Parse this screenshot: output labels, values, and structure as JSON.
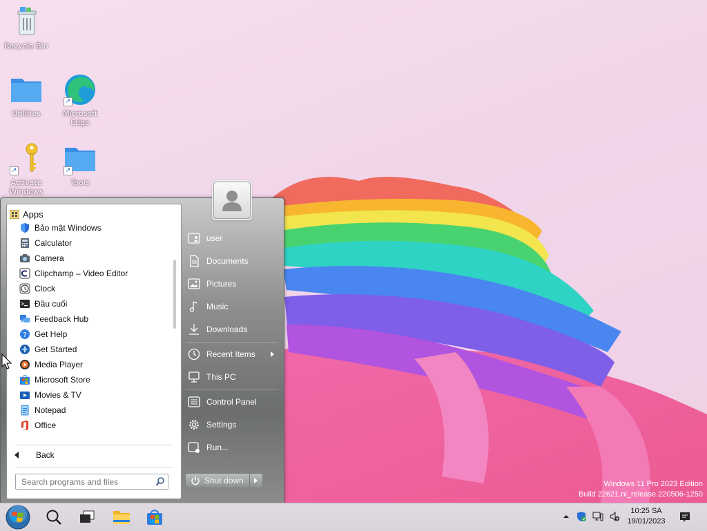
{
  "desktop": {
    "icons": [
      {
        "label": "Recycle Bin",
        "icon": "recycle-bin-icon"
      },
      {
        "label": "Utilities",
        "icon": "folder-icon"
      },
      {
        "label": "Microsoft Edge",
        "icon": "edge-icon"
      },
      {
        "label": "Activate Windows",
        "icon": "key-icon"
      },
      {
        "label": "Tools",
        "icon": "folder-shortcut-icon"
      }
    ]
  },
  "start_menu": {
    "apps_header": "Apps",
    "apps": [
      {
        "label": "Bảo mật Windows",
        "icon": "shield-icon"
      },
      {
        "label": "Calculator",
        "icon": "calculator-icon"
      },
      {
        "label": "Camera",
        "icon": "camera-icon"
      },
      {
        "label": "Clipchamp – Video Editor",
        "icon": "clipchamp-icon"
      },
      {
        "label": "Clock",
        "icon": "clock-icon"
      },
      {
        "label": "Đầu cuối",
        "icon": "terminal-icon"
      },
      {
        "label": "Feedback Hub",
        "icon": "feedback-icon"
      },
      {
        "label": "Get Help",
        "icon": "help-icon"
      },
      {
        "label": "Get Started",
        "icon": "get-started-icon"
      },
      {
        "label": "Media Player",
        "icon": "media-player-icon"
      },
      {
        "label": "Microsoft Store",
        "icon": "store-icon"
      },
      {
        "label": "Movies & TV",
        "icon": "movies-icon"
      },
      {
        "label": "Notepad",
        "icon": "notepad-icon"
      },
      {
        "label": "Office",
        "icon": "office-icon"
      }
    ],
    "back_label": "Back",
    "search_placeholder": "Search programs and files",
    "right_items": [
      {
        "label": "user",
        "icon": "user-folder-icon"
      },
      {
        "label": "Documents",
        "icon": "documents-icon"
      },
      {
        "label": "Pictures",
        "icon": "pictures-icon"
      },
      {
        "label": "Music",
        "icon": "music-icon"
      },
      {
        "label": "Downloads",
        "icon": "downloads-icon"
      },
      {
        "label": "Recent Items",
        "icon": "recent-icon"
      },
      {
        "label": "This PC",
        "icon": "this-pc-icon"
      },
      {
        "label": "Control Panel",
        "icon": "control-panel-icon"
      },
      {
        "label": "Settings",
        "icon": "settings-icon"
      },
      {
        "label": "Run...",
        "icon": "run-icon"
      }
    ],
    "shutdown_label": "Shut down"
  },
  "watermark": {
    "line1": "Windows 11 Pro 2023 Edition",
    "line2": "Build 22621.ni_release.220506-1250"
  },
  "taskbar": {
    "items": [
      "start-orb-icon",
      "search-icon",
      "task-view-icon",
      "file-explorer-icon",
      "store-icon"
    ],
    "time": "10:25 SA",
    "date": "19/01/2023"
  },
  "colors": {
    "desktop_bg": "#f3d9ec",
    "start_menu_glass": "#8e908f",
    "taskbar": "#ddd7de"
  }
}
